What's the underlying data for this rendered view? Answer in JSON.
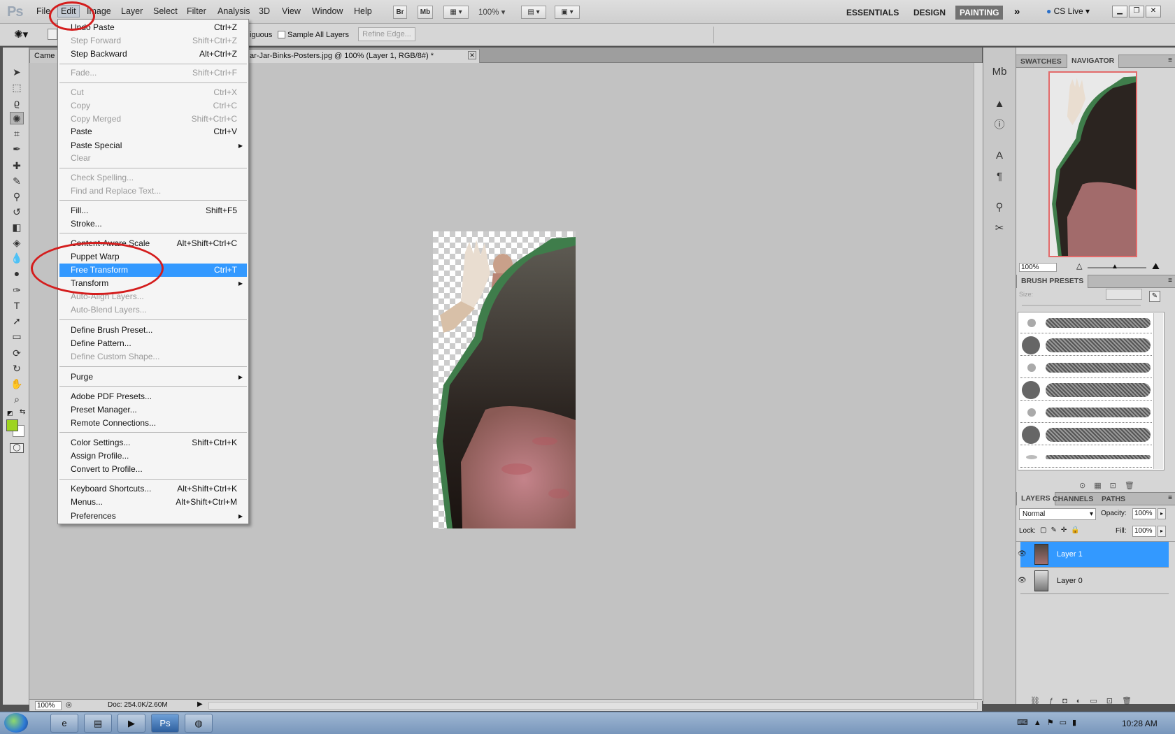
{
  "app": {
    "logo": "Ps",
    "menus": [
      "File",
      "Edit",
      "Image",
      "Layer",
      "Select",
      "Filter",
      "Analysis",
      "3D",
      "View",
      "Window",
      "Help"
    ],
    "active_menu": "Edit",
    "toolbar_badges": [
      "Br",
      "Mb"
    ],
    "zoom_select": "100%",
    "workspaces": [
      "ESSENTIALS",
      "DESIGN",
      "PAINTING"
    ],
    "active_workspace": "PAINTING",
    "cs_live": "CS Live"
  },
  "options_bar": {
    "contiguous_partial": "iguous",
    "sample_all_layers": "Sample All Layers",
    "refine_edge": "Refine Edge..."
  },
  "document": {
    "tab_left_partial": "Came",
    "tab_title": "ar-Jar-Binks-Posters.jpg @ 100% (Layer 1, RGB/8#) *",
    "zoom": "100%",
    "doc_info": "Doc: 254.0K/2.60M"
  },
  "edit_menu": {
    "items": [
      {
        "label": "Undo Paste",
        "shortcut": "Ctrl+Z",
        "disabled": false
      },
      {
        "label": "Step Forward",
        "shortcut": "Shift+Ctrl+Z",
        "disabled": true
      },
      {
        "label": "Step Backward",
        "shortcut": "Alt+Ctrl+Z",
        "disabled": false
      },
      {
        "label": "Fade...",
        "shortcut": "Shift+Ctrl+F",
        "disabled": true
      },
      {
        "label": "Cut",
        "shortcut": "Ctrl+X",
        "disabled": true
      },
      {
        "label": "Copy",
        "shortcut": "Ctrl+C",
        "disabled": true
      },
      {
        "label": "Copy Merged",
        "shortcut": "Shift+Ctrl+C",
        "disabled": true
      },
      {
        "label": "Paste",
        "shortcut": "Ctrl+V",
        "disabled": false
      },
      {
        "label": "Paste Special",
        "shortcut": "",
        "disabled": false,
        "submenu": true
      },
      {
        "label": "Clear",
        "shortcut": "",
        "disabled": true
      },
      {
        "label": "Check Spelling...",
        "shortcut": "",
        "disabled": true
      },
      {
        "label": "Find and Replace Text...",
        "shortcut": "",
        "disabled": true
      },
      {
        "label": "Fill...",
        "shortcut": "Shift+F5",
        "disabled": false
      },
      {
        "label": "Stroke...",
        "shortcut": "",
        "disabled": false
      },
      {
        "label": "Content-Aware Scale",
        "shortcut": "Alt+Shift+Ctrl+C",
        "disabled": false
      },
      {
        "label": "Puppet Warp",
        "shortcut": "",
        "disabled": false
      },
      {
        "label": "Free Transform",
        "shortcut": "Ctrl+T",
        "disabled": false,
        "highlighted": true
      },
      {
        "label": "Transform",
        "shortcut": "",
        "disabled": false,
        "submenu": true
      },
      {
        "label": "Auto-Align Layers...",
        "shortcut": "",
        "disabled": true
      },
      {
        "label": "Auto-Blend Layers...",
        "shortcut": "",
        "disabled": true
      },
      {
        "label": "Define Brush Preset...",
        "shortcut": "",
        "disabled": false
      },
      {
        "label": "Define Pattern...",
        "shortcut": "",
        "disabled": false
      },
      {
        "label": "Define Custom Shape...",
        "shortcut": "",
        "disabled": true
      },
      {
        "label": "Purge",
        "shortcut": "",
        "disabled": false,
        "submenu": true
      },
      {
        "label": "Adobe PDF Presets...",
        "shortcut": "",
        "disabled": false
      },
      {
        "label": "Preset Manager...",
        "shortcut": "",
        "disabled": false
      },
      {
        "label": "Remote Connections...",
        "shortcut": "",
        "disabled": false
      },
      {
        "label": "Color Settings...",
        "shortcut": "Shift+Ctrl+K",
        "disabled": false
      },
      {
        "label": "Assign Profile...",
        "shortcut": "",
        "disabled": false
      },
      {
        "label": "Convert to Profile...",
        "shortcut": "",
        "disabled": false
      },
      {
        "label": "Keyboard Shortcuts...",
        "shortcut": "Alt+Shift+Ctrl+K",
        "disabled": false
      },
      {
        "label": "Menus...",
        "shortcut": "Alt+Shift+Ctrl+M",
        "disabled": false
      },
      {
        "label": "Preferences",
        "shortcut": "",
        "disabled": false,
        "submenu": true
      }
    ]
  },
  "panels": {
    "nav_tabs": [
      "SWATCHES",
      "NAVIGATOR"
    ],
    "nav_zoom": "100%",
    "brush_title": "BRUSH PRESETS",
    "brush_size_label": "Size:",
    "layer_tabs": [
      "LAYERS",
      "CHANNELS",
      "PATHS"
    ],
    "blend_mode": "Normal",
    "opacity_label": "Opacity:",
    "opacity": "100%",
    "lock_label": "Lock:",
    "fill_label": "Fill:",
    "fill": "100%",
    "layers": [
      {
        "name": "Layer 1",
        "selected": true
      },
      {
        "name": "Layer 0",
        "selected": false
      }
    ]
  },
  "taskbar": {
    "time": "10:28 AM"
  },
  "colors": {
    "foreground": "#9ed41f",
    "highlight": "#3399ff",
    "annotation": "#d41d1d"
  }
}
